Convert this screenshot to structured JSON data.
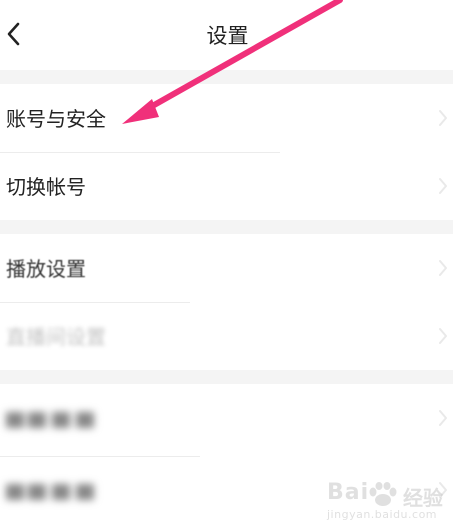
{
  "header": {
    "title": "设置",
    "back_icon": "chevron-left-icon"
  },
  "groups": [
    {
      "items": [
        {
          "label": "账号与安全"
        },
        {
          "label": "切换帐号"
        }
      ]
    },
    {
      "items": [
        {
          "label": "播放设置"
        },
        {
          "label": "直播间设置"
        }
      ]
    },
    {
      "items": [
        {
          "label": ""
        },
        {
          "label": ""
        }
      ]
    }
  ],
  "annotation": {
    "arrow_color": "#f0307a"
  },
  "watermark": {
    "brand": "Bai",
    "suffix": "经验",
    "sub": "jingyan.baidu.com"
  }
}
